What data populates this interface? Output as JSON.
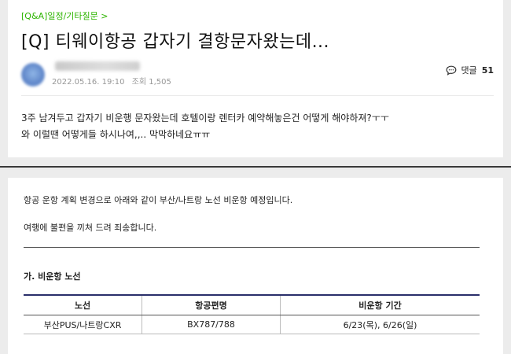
{
  "post": {
    "breadcrumb": "[Q&A]일정/기타질문 >",
    "title": "[Q] 티웨이항공 갑자기 결항문자왔는데...",
    "date": "2022.05.16. 19:10",
    "views": "조회 1,505",
    "comment_label": "댓글",
    "comment_count": "51",
    "body_lines": [
      "3주 남겨두고 갑자기 비운행 문자왔는데 호텔이랑 렌터카 예약해놓은건 어떻게 해야하져?ㅜㅜ",
      "와 이럴땐 어떻게들 하시나여,,.. 막막하네요ㅠㅠ"
    ]
  },
  "notice": {
    "line1": "항공 운항 계획 변경으로 아래와 같이 부산/나트랑 노선 비운항 예정입니다.",
    "line2": "여행에 불편을 끼쳐 드려 죄송합니다.",
    "section_title": "가. 비운항 노선",
    "table": {
      "headers": [
        "노선",
        "항공편명",
        "비운항 기간"
      ],
      "rows": [
        [
          "부산PUS/나트랑CXR",
          "BX787/788",
          "6/23(목), 6/26(일)"
        ]
      ]
    }
  },
  "colors": {
    "breadcrumb": "#2db400",
    "table_top_border": "#2a2f6a",
    "background": "#ececec"
  },
  "icons": {
    "comment": "speech-bubble-icon"
  }
}
